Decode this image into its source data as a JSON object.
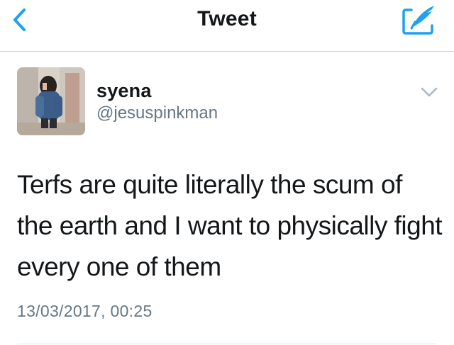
{
  "nav": {
    "title": "Tweet",
    "back_icon": "chevron-left-icon",
    "compose_icon": "compose-tweet-icon",
    "accent_color": "#1da1f2"
  },
  "tweet": {
    "author_name": "syena",
    "author_handle": "@jesuspinkman",
    "text": "Terfs are quite literally the scum of the earth and I want to physically fight every one of them",
    "timestamp": "13/03/2017, 00:25",
    "menu_icon": "chevron-down-icon"
  }
}
